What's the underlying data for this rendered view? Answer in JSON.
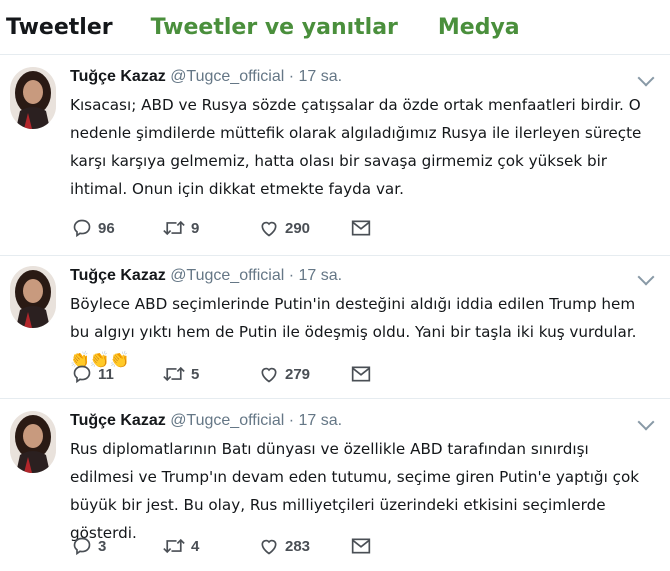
{
  "tabs": [
    "Tweetler",
    "Tweetler ve yanıtlar",
    "Medya"
  ],
  "tweets": [
    {
      "name": "Tuğçe Kazaz",
      "handle": "@Tugce_official",
      "time": "· 17 sa.",
      "text": "Kısacası; ABD ve Rusya sözde çatışsalar da özde ortak menfaatleri birdir. O nedenle şimdilerde müttefik olarak algıladığımız Rusya ile ilerleyen süreçte karşı karşıya gelmemiz, hatta olası bir savaşa girmemiz çok yüksek bir ihtimal. Onun için dikkat etmekte fayda var.",
      "replies": "96",
      "retweets": "9",
      "likes": "290"
    },
    {
      "name": "Tuğçe Kazaz",
      "handle": "@Tugce_official",
      "time": "· 17 sa.",
      "text": "Böylece ABD seçimlerinde Putin'in desteğini aldığı iddia edilen Trump hem bu algıyı yıktı hem de Putin ile ödeşmiş oldu. Yani bir taşla iki kuş vurdular.",
      "emoji": "👏👏👏",
      "replies": "11",
      "retweets": "5",
      "likes": "279"
    },
    {
      "name": "Tuğçe Kazaz",
      "handle": "@Tugce_official",
      "time": "· 17 sa.",
      "text": "Rus diplomatlarının Batı dünyası ve özellikle ABD tarafından sınırdışı edilmesi ve Trump'ın devam eden tutumu, seçime giren Putin'e yaptığı çok büyük bir jest. Bu olay, Rus milliyetçileri üzerindeki etkisini seçimlerde gösterdi.",
      "replies": "3",
      "retweets": "4",
      "likes": "283"
    }
  ],
  "icons": [
    "reply-icon",
    "retweet-icon",
    "like-icon",
    "message-icon",
    "chevron-down-icon"
  ],
  "colors": {
    "tab_green": "#4a8f3c",
    "text": "#14171a",
    "muted": "#657786",
    "divider": "#e6ecf0"
  }
}
